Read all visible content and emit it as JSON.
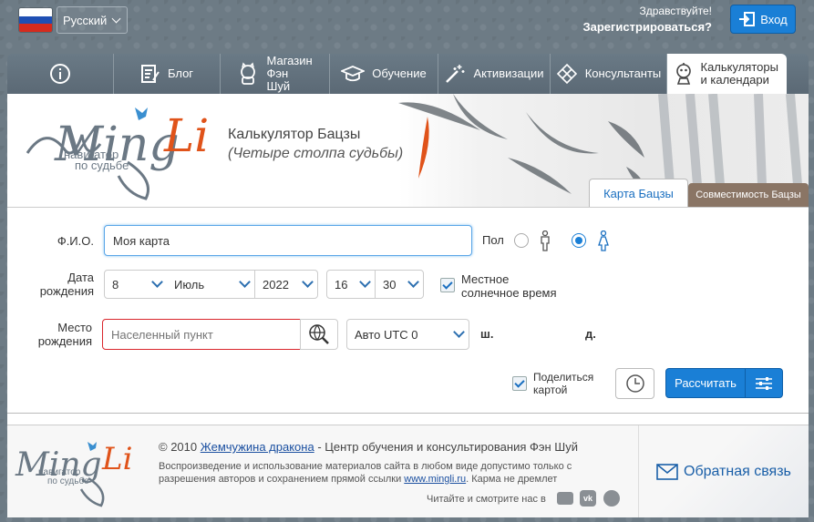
{
  "topbar": {
    "language": "Русский",
    "greeting": "Здравствуйте!",
    "register": "Зарегистрироваться?",
    "login": "Вход"
  },
  "nav": [
    {
      "icon": "info-icon",
      "label": ""
    },
    {
      "icon": "blog-icon",
      "label": "Блог"
    },
    {
      "icon": "cat-icon",
      "label": "Магазин Фэн Шуй"
    },
    {
      "icon": "graduation-cap-icon",
      "label": "Обучение"
    },
    {
      "icon": "magic-wand-icon",
      "label": "Активизации"
    },
    {
      "icon": "knot-icon",
      "label": "Консультанты"
    },
    {
      "icon": "robot-icon",
      "label": "Калькуляторы и календари"
    }
  ],
  "header": {
    "logo_text": "Ming Li",
    "logo_sub": "навигатор по судьбе",
    "title": "Калькулятор Бацзы",
    "subtitle": "(Четыре столпа судьбы)",
    "tab_active": "Карта Бацзы",
    "tab_other": "Совместимость Бацзы"
  },
  "form": {
    "name_label": "Ф.И.О.",
    "name_value": "Моя карта",
    "gender_label": "Пол",
    "birth_label": "Дата рождения",
    "day": "8",
    "month": "Июль",
    "year": "2022",
    "hour": "16",
    "minute": "30",
    "solar_label": "Местное солнечное время",
    "place_label": "Место рождения",
    "place_placeholder": "Населенный пункт",
    "tz": "Авто UTC 0",
    "lat": "ш.",
    "lon": "д.",
    "share_label": "Поделиться картой",
    "calc_button": "Рассчитать"
  },
  "footer": {
    "copyright": "© 2010",
    "link": "Жемчужина дракона",
    "org": "- Центр обучения и консультирования Фэн Шуй",
    "notice": "Воспроизведение и использование материалов сайта в любом виде допустимо только с разрешения авторов и сохранением прямой ссылки",
    "site": "www.mingli.ru",
    "karma": ". Карма не дремлет",
    "social": "Читайте и смотрите нас в",
    "feedback": "Обратная связь"
  },
  "colors": {
    "accent": "#1a7fd6",
    "brand": "#e0531a",
    "nav": "#5f6e7a"
  }
}
